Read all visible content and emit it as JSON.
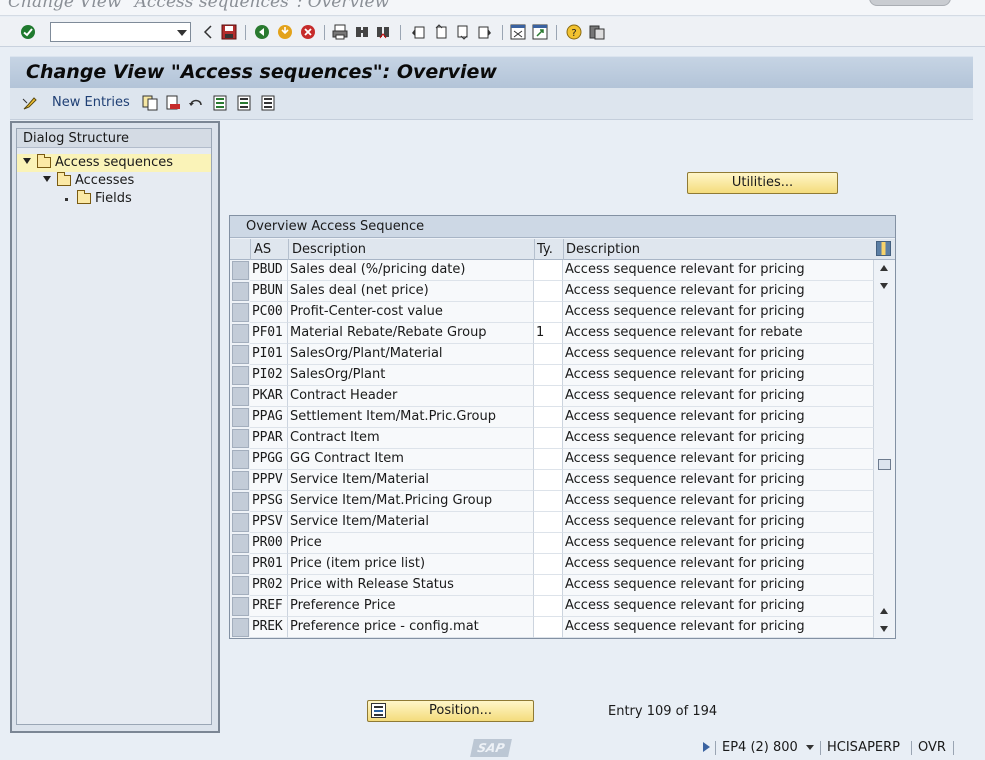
{
  "window": {
    "title": "Change View \"Access sequences\": Overview"
  },
  "system_toolbar": {
    "command_field_value": "",
    "icons": [
      "enter-icon",
      "back-icon",
      "save-icon",
      "back-green-icon",
      "exit-icon",
      "cancel-icon",
      "print-icon",
      "find-icon",
      "find-next-icon",
      "first-page-icon",
      "prev-page-icon",
      "next-page-icon",
      "last-page-icon",
      "create-session-icon",
      "shortcut-icon",
      "help-icon",
      "layout-icon"
    ]
  },
  "page_title": "Change View \"Access sequences\": Overview",
  "app_toolbar": {
    "new_entries_label": "New Entries"
  },
  "dialog_structure": {
    "header": "Dialog Structure",
    "items": [
      {
        "label": "Access sequences",
        "level": 0,
        "selected": true
      },
      {
        "label": "Accesses",
        "level": 1,
        "selected": false
      },
      {
        "label": "Fields",
        "level": 2,
        "selected": false
      }
    ]
  },
  "utilities_button": "Utilities...",
  "table": {
    "caption": "Overview Access Sequence",
    "columns": [
      "AS",
      "Description",
      "Ty.",
      "Description"
    ],
    "rows": [
      {
        "as": "PBUD",
        "desc": "Sales deal (%/pricing date)",
        "ty": "",
        "desc2": "Access sequence relevant for pricing"
      },
      {
        "as": "PBUN",
        "desc": "Sales deal (net price)",
        "ty": "",
        "desc2": "Access sequence relevant for pricing"
      },
      {
        "as": "PC00",
        "desc": "Profit-Center-cost value",
        "ty": "",
        "desc2": "Access sequence relevant for pricing"
      },
      {
        "as": "PF01",
        "desc": "Material Rebate/Rebate Group",
        "ty": "1",
        "desc2": "Access sequence relevant for rebate"
      },
      {
        "as": "PI01",
        "desc": "SalesOrg/Plant/Material",
        "ty": "",
        "desc2": "Access sequence relevant for pricing"
      },
      {
        "as": "PI02",
        "desc": "SalesOrg/Plant",
        "ty": "",
        "desc2": "Access sequence relevant for pricing"
      },
      {
        "as": "PKAR",
        "desc": "Contract Header",
        "ty": "",
        "desc2": "Access sequence relevant for pricing"
      },
      {
        "as": "PPAG",
        "desc": "Settlement Item/Mat.Pric.Group",
        "ty": "",
        "desc2": "Access sequence relevant for pricing"
      },
      {
        "as": "PPAR",
        "desc": "Contract Item",
        "ty": "",
        "desc2": "Access sequence relevant for pricing"
      },
      {
        "as": "PPGG",
        "desc": "GG Contract Item",
        "ty": "",
        "desc2": "Access sequence relevant for pricing"
      },
      {
        "as": "PPPV",
        "desc": "Service Item/Material",
        "ty": "",
        "desc2": "Access sequence relevant for pricing"
      },
      {
        "as": "PPSG",
        "desc": "Service Item/Mat.Pricing Group",
        "ty": "",
        "desc2": "Access sequence relevant for pricing"
      },
      {
        "as": "PPSV",
        "desc": "Service Item/Material",
        "ty": "",
        "desc2": "Access sequence relevant for pricing"
      },
      {
        "as": "PR00",
        "desc": "Price",
        "ty": "",
        "desc2": "Access sequence relevant for pricing"
      },
      {
        "as": "PR01",
        "desc": "Price (item price list)",
        "ty": "",
        "desc2": "Access sequence relevant for pricing"
      },
      {
        "as": "PR02",
        "desc": "Price with Release Status",
        "ty": "",
        "desc2": "Access sequence relevant for pricing"
      },
      {
        "as": "PREF",
        "desc": "Preference Price",
        "ty": "",
        "desc2": "Access sequence relevant for pricing"
      },
      {
        "as": "PREK",
        "desc": "Preference price - config.mat",
        "ty": "",
        "desc2": "Access sequence relevant for pricing"
      }
    ]
  },
  "position_button": "Position...",
  "entry_info": "Entry 109 of 194",
  "status_bar": {
    "sap_logo": "SAP",
    "system": "EP4 (2) 800",
    "server": "HCISAPERP",
    "mode": "OVR"
  }
}
